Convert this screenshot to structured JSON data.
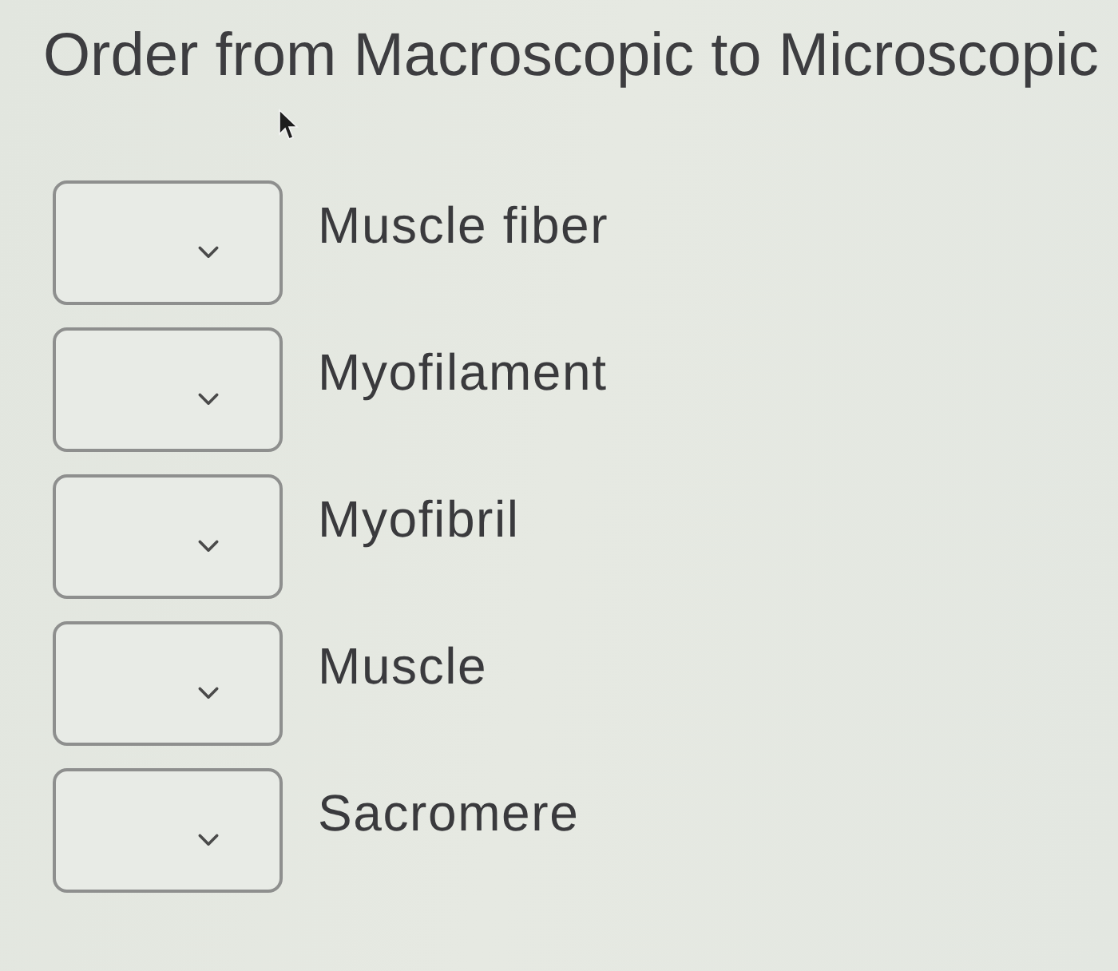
{
  "question": {
    "title": "Order from Macroscopic to Microscopic"
  },
  "items": [
    {
      "label": "Muscle fiber"
    },
    {
      "label": "Myofilament"
    },
    {
      "label": "Myofibril"
    },
    {
      "label": "Muscle"
    },
    {
      "label": "Sacromere"
    }
  ]
}
